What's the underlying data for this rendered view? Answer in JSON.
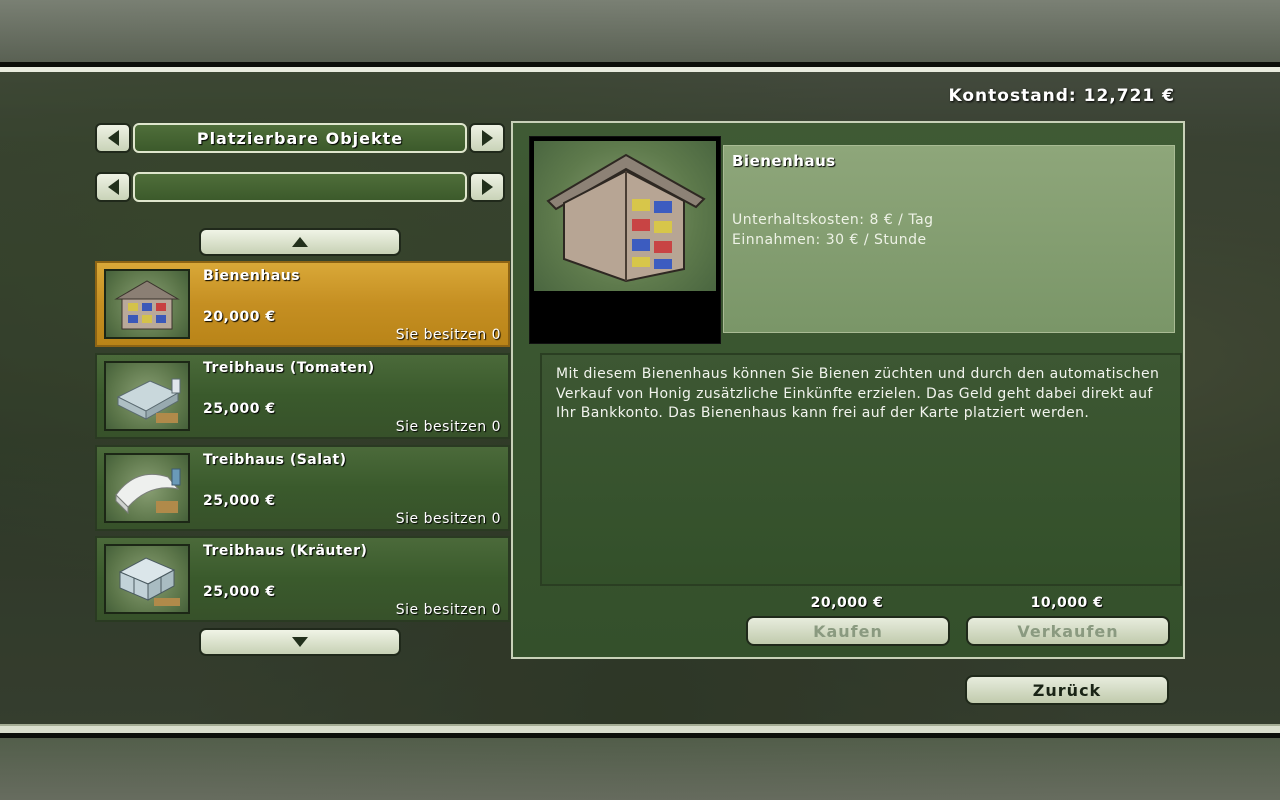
{
  "header": {
    "balance_label": "Kontostand: 12,721 €"
  },
  "category_selector": {
    "label": "Platzierbare Objekte"
  },
  "subcategory_selector": {
    "label": ""
  },
  "items": [
    {
      "name": "Bienenhaus",
      "price": "20,000 €",
      "owned": "Sie besitzen 0",
      "selected": true
    },
    {
      "name": "Treibhaus (Tomaten)",
      "price": "25,000 €",
      "owned": "Sie besitzen 0",
      "selected": false
    },
    {
      "name": "Treibhaus (Salat)",
      "price": "25,000 €",
      "owned": "Sie besitzen 0",
      "selected": false
    },
    {
      "name": "Treibhaus (Kräuter)",
      "price": "25,000 €",
      "owned": "Sie besitzen 0",
      "selected": false
    }
  ],
  "detail": {
    "title": "Bienenhaus",
    "upkeep": "Unterhaltskosten: 8 € / Tag",
    "income": "Einnahmen: 30 € / Stunde",
    "description": "Mit diesem Bienenhaus können Sie Bienen züchten und durch den automatischen Verkauf von Honig zusätzliche Einkünfte erzielen. Das Geld geht dabei direkt auf Ihr Bankkonto. Das Bienenhaus kann frei auf der Karte platziert werden.",
    "buy_price": "20,000 €",
    "sell_price": "10,000 €",
    "buy_label": "Kaufen",
    "sell_label": "Verkaufen"
  },
  "footer": {
    "back_label": "Zurück"
  },
  "icons": {
    "left_arrow": "left-arrow-icon",
    "right_arrow": "right-arrow-icon",
    "scroll_up": "arrow-up-icon",
    "scroll_down": "arrow-down-icon"
  },
  "colors": {
    "selected_item": "#c58f22",
    "item_bg": "#3a5a2c",
    "panel_bg": "#3f5a34",
    "button_bg": "#dfe6d0"
  }
}
